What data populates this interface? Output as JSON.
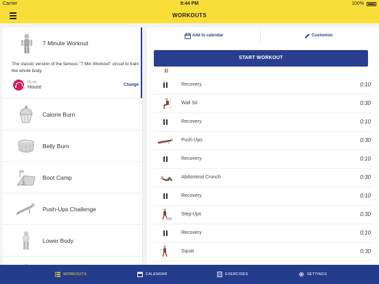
{
  "status_bar": {
    "carrier": "Carrier",
    "time": "9:44 PM",
    "battery": "100%"
  },
  "header": {
    "title": "WORKOUTS",
    "menu_icon": "hamburger-menu-icon"
  },
  "featured_workout": {
    "title": "7 Minute Workout",
    "description": "The classic version of the famous \"7 Min Workout\" circuit to train the whole body",
    "music_label": "Music",
    "music_value": "House",
    "change_label": "Change"
  },
  "workouts": [
    {
      "label": "Calorie Burn",
      "icon": "cupcake-icon"
    },
    {
      "label": "Belly Burn",
      "icon": "belly-icon"
    },
    {
      "label": "Boot Camp",
      "icon": "tent-icon"
    },
    {
      "label": "Push-Ups Challenge",
      "icon": "pushup-icon"
    },
    {
      "label": "Lower Body",
      "icon": "lower-body-icon"
    }
  ],
  "actions": {
    "add_to_calendar": "Add to calendar",
    "customize": "Customize"
  },
  "start_button": "START WORKOUT",
  "exercises": [
    {
      "name": "Recovery",
      "duration": "0:10",
      "type": "pause"
    },
    {
      "name": "Wall Sit",
      "duration": "0:30",
      "type": "exercise"
    },
    {
      "name": "Recovery",
      "duration": "0:10",
      "type": "pause"
    },
    {
      "name": "Push-Ups",
      "duration": "0:30",
      "type": "exercise"
    },
    {
      "name": "Recovery",
      "duration": "0:10",
      "type": "pause"
    },
    {
      "name": "Abdominal Crunch",
      "duration": "0:30",
      "type": "exercise"
    },
    {
      "name": "Recovery",
      "duration": "0:10",
      "type": "pause"
    },
    {
      "name": "Step-Ups",
      "duration": "0:30",
      "type": "exercise"
    },
    {
      "name": "Recovery",
      "duration": "0:10",
      "type": "pause"
    },
    {
      "name": "Squat",
      "duration": "0:30",
      "type": "exercise"
    }
  ],
  "tabs": [
    {
      "label": "WORKOUTS",
      "icon": "list-icon",
      "active": true
    },
    {
      "label": "CALENDAR",
      "icon": "calendar-icon",
      "active": false
    },
    {
      "label": "EXERCISES",
      "icon": "document-icon",
      "active": false
    },
    {
      "label": "SETTINGS",
      "icon": "gear-icon",
      "active": false
    }
  ],
  "colors": {
    "header": "#f9de3a",
    "primary": "#2a3e8f",
    "tabbar": "#233c8c",
    "music": "#d81b60"
  }
}
